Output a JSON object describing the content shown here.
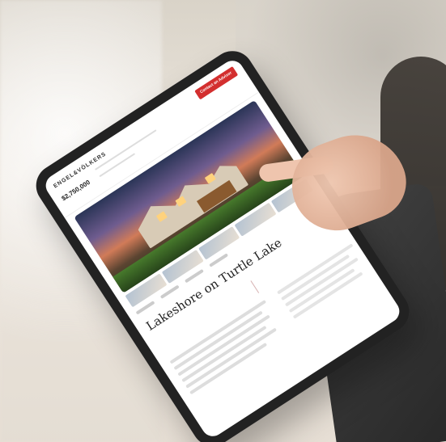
{
  "screen": {
    "brand_text": "ENGEL&VÖLKERS",
    "contact_button_text": "Contact an Advisor",
    "price_text": "$2,750,000",
    "headline": "Lakeshore on Turtle Lake"
  }
}
